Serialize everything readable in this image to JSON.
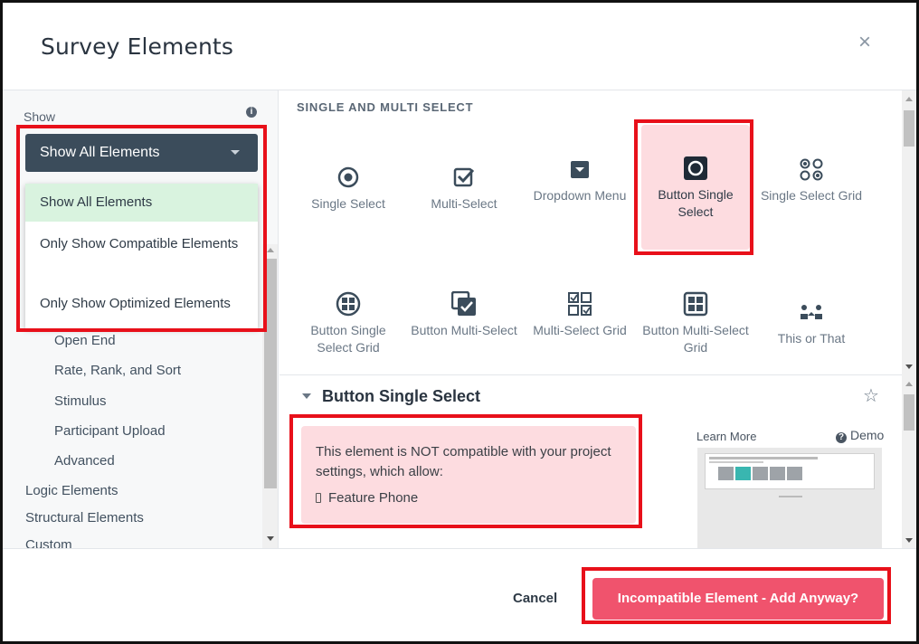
{
  "modal": {
    "title": "Survey Elements",
    "close_icon": "×"
  },
  "colors": {
    "accent_red": "#f0536d",
    "highlight_red": "#e8101a",
    "select_dark": "#3b4c5b",
    "selected_green": "#d9f3df",
    "selected_pink": "#fddce0"
  },
  "sidebar": {
    "show_label": "Show",
    "info_icon": "i",
    "select_value": "Show All Elements",
    "dropdown_options": [
      "Show All Elements",
      "Only Show Compatible Elements",
      "Only Show Optimized Elements"
    ],
    "items": [
      "Open End",
      "Rate, Rank, and Sort",
      "Stimulus",
      "Participant Upload",
      "Advanced",
      "Logic Elements",
      "Structural Elements",
      "Custom"
    ]
  },
  "section": {
    "title": "SINGLE AND MULTI SELECT",
    "tiles": [
      {
        "label": "Single Select",
        "icon": "radio-icon"
      },
      {
        "label": "Multi-Select",
        "icon": "checkbox-icon"
      },
      {
        "label": "Dropdown Menu",
        "icon": "dropdown-icon"
      },
      {
        "label": "Button Single Select",
        "icon": "button-radio-icon"
      },
      {
        "label": "Single Select Grid",
        "icon": "radio-grid-icon"
      },
      {
        "label": "Button Single Select Grid",
        "icon": "button-grid-icon"
      },
      {
        "label": "Button Multi-Select",
        "icon": "button-checkbox-icon"
      },
      {
        "label": "Multi-Select Grid",
        "icon": "checkbox-grid-icon"
      },
      {
        "label": "Button Multi-Select Grid",
        "icon": "button-checkbox-grid-icon"
      },
      {
        "label": "This or That",
        "icon": "this-or-that-icon"
      }
    ],
    "selected": "Button Single Select"
  },
  "detail": {
    "title": "Button Single Select",
    "warning": "This element is NOT compatible with your project settings, which allow:",
    "device": "Feature Phone",
    "learn_more": "Learn More",
    "demo": "Demo"
  },
  "footer": {
    "cancel": "Cancel",
    "add": "Incompatible Element - Add Anyway?"
  }
}
